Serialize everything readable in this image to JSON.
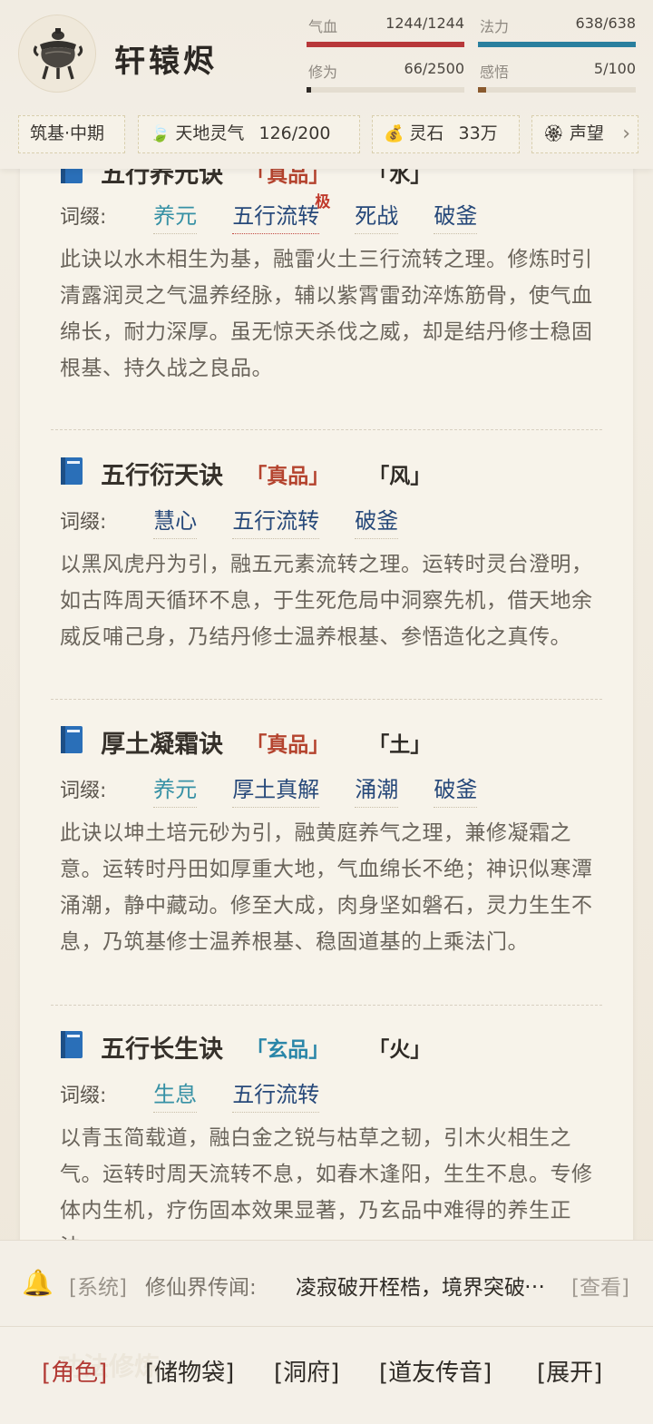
{
  "player": {
    "name": "轩辕烬",
    "avatar_icon": "incense-burner-icon"
  },
  "stats": {
    "hp": {
      "label": "气血",
      "value": "1244/1244",
      "fraction": 1.0,
      "color": "#b8383a"
    },
    "mp": {
      "label": "法力",
      "value": "638/638",
      "fraction": 1.0,
      "color": "#2a7f9e"
    },
    "cult": {
      "label": "修为",
      "value": "66/2500",
      "fraction": 0.026,
      "color": "#2e2a26"
    },
    "insight": {
      "label": "感悟",
      "value": "5/100",
      "fraction": 0.05,
      "color": "#8a5a2e"
    }
  },
  "chips": {
    "realm": "筑基·中期",
    "qi_label": "天地灵气",
    "qi_value": "126/200",
    "stone_label": "灵石",
    "stone_value": "33万",
    "fame_label": "声望",
    "more": "›"
  },
  "affix_label": "词缀:",
  "items": [
    {
      "name": "五行养元诀",
      "grade": "「真品」",
      "element": "「水」",
      "affixes": [
        "养元",
        "五行流转",
        "死战",
        "破釜"
      ],
      "affix_badge": "极",
      "description": "此诀以水木相生为基，融雷火土三行流转之理。修炼时引清露润灵之气温养经脉，辅以紫霄雷劲淬炼筋骨，使气血绵长，耐力深厚。虽无惊天杀伐之威，却是结丹修士稳固根基、持久战之良品。"
    },
    {
      "name": "五行衍天诀",
      "grade": "「真品」",
      "element": "「风」",
      "affixes": [
        "慧心",
        "五行流转",
        "破釜"
      ],
      "description": "以黑风虎丹为引，融五元素流转之理。运转时灵台澄明，如古阵周天循环不息，于生死危局中洞察先机，借天地余威反哺己身，乃结丹修士温养根基、参悟造化之真传。"
    },
    {
      "name": "厚土凝霜诀",
      "grade": "「真品」",
      "element": "「土」",
      "affixes": [
        "养元",
        "厚土真解",
        "涌潮",
        "破釜"
      ],
      "description": "此诀以坤土培元砂为引，融黄庭养气之理，兼修凝霜之意。运转时丹田如厚重大地，气血绵长不绝；神识似寒潭涌潮，静中藏动。修至大成，肉身坚如磐石，灵力生生不息，乃筑基修士温养根基、稳固道基的上乘法门。"
    },
    {
      "name": "五行长生诀",
      "grade": "「玄品」",
      "element": "「火」",
      "affixes": [
        "生息",
        "五行流转"
      ],
      "description": "以青玉简载道，融白金之锐与枯草之韧，引木火相生之气。运转时周天流转不息，如春木逢阳，生生不息。专修体内生机，疗伤固本效果显著，乃玄品中难得的养生正法。"
    }
  ],
  "notice": {
    "tag": "[系统]",
    "label": "修仙界传闻:",
    "message": "凌寂破开桎梏，境界突破",
    "view": "[查看]"
  },
  "nav": {
    "ghost_title": "功法修炼",
    "items": [
      "[角色]",
      "[储物袋]",
      "[洞府]",
      "[道友传音]",
      "[展开]"
    ],
    "active_index": 0
  },
  "colors": {
    "grade_true": "#b4432e",
    "grade_mystic": "#2a86a8",
    "accent_red": "#b23a34"
  }
}
